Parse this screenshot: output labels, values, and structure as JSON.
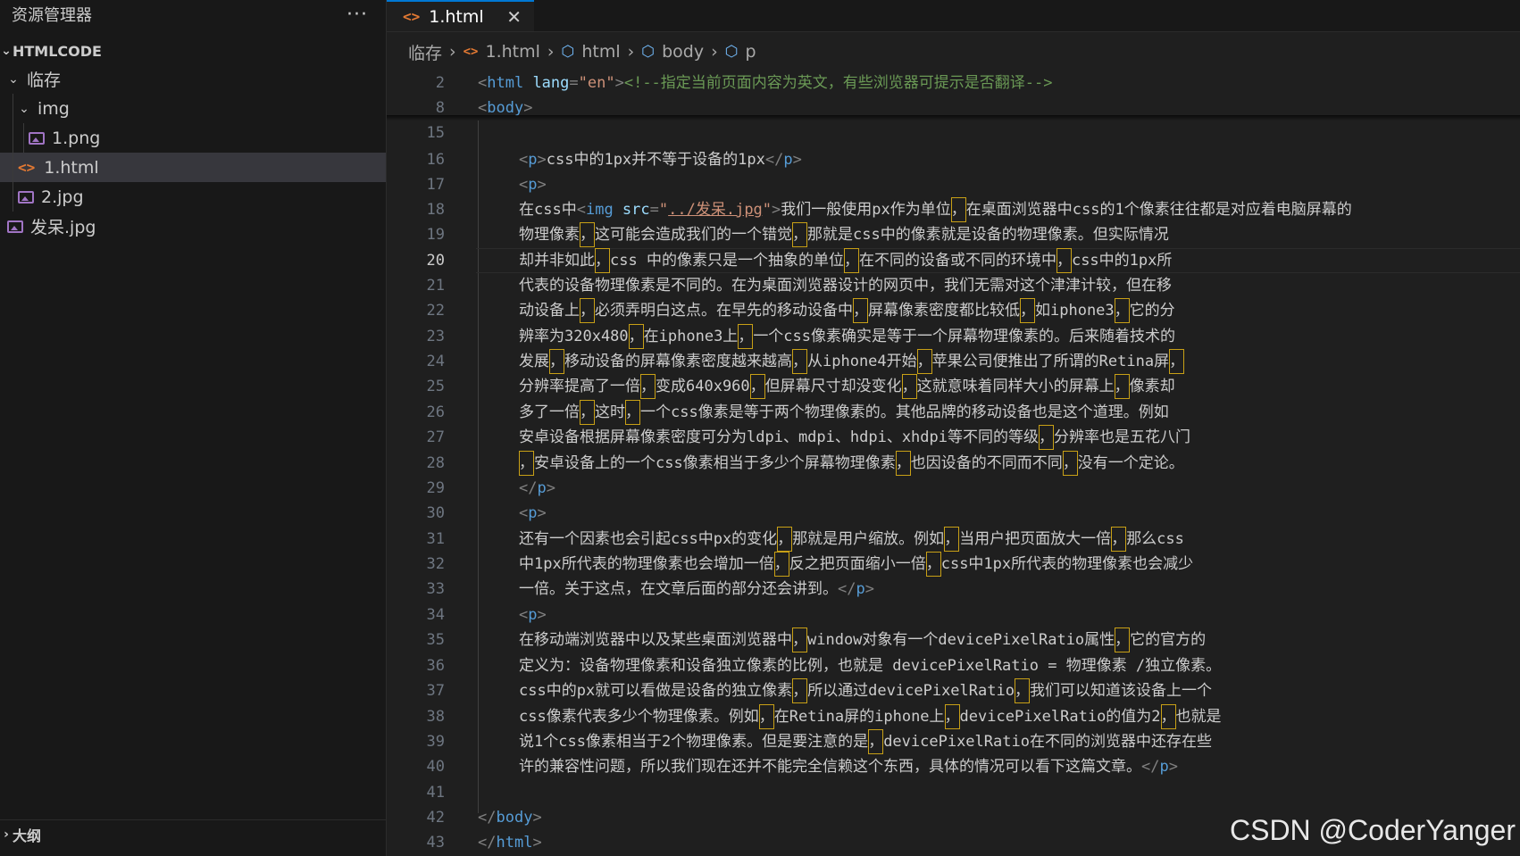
{
  "sidebar": {
    "title": "资源管理器",
    "more": "···",
    "section": "HTMLCODE",
    "items": [
      {
        "label": "临存",
        "kind": "folder"
      },
      {
        "label": "img",
        "kind": "folder"
      },
      {
        "label": "1.png",
        "kind": "image"
      },
      {
        "label": "1.html",
        "kind": "html"
      },
      {
        "label": "2.jpg",
        "kind": "image"
      },
      {
        "label": "发呆.jpg",
        "kind": "image"
      }
    ],
    "outline": "大纲"
  },
  "tab": {
    "label": "1.html",
    "close": "✕"
  },
  "breadcrumb": [
    "临存",
    "1.html",
    "html",
    "body",
    "p"
  ],
  "code": {
    "active_line": "20",
    "lines": [
      {
        "n": "2"
      },
      {
        "n": "8"
      },
      {
        "n": "15"
      },
      {
        "n": "16"
      },
      {
        "n": "17"
      },
      {
        "n": "18"
      },
      {
        "n": "19"
      },
      {
        "n": "20"
      },
      {
        "n": "21"
      },
      {
        "n": "22"
      },
      {
        "n": "23"
      },
      {
        "n": "24"
      },
      {
        "n": "25"
      },
      {
        "n": "26"
      },
      {
        "n": "27"
      },
      {
        "n": "28"
      },
      {
        "n": "29"
      },
      {
        "n": "30"
      },
      {
        "n": "31"
      },
      {
        "n": "32"
      },
      {
        "n": "33"
      },
      {
        "n": "34"
      },
      {
        "n": "35"
      },
      {
        "n": "36"
      },
      {
        "n": "37"
      },
      {
        "n": "38"
      },
      {
        "n": "39"
      },
      {
        "n": "40"
      },
      {
        "n": "41"
      },
      {
        "n": "42"
      },
      {
        "n": "43"
      }
    ],
    "l2": {
      "lt": "<",
      "tag": "html",
      "attr": " lang",
      "eq": "=",
      "val": "\"en\"",
      "gt": ">",
      "comment": "<!--指定当前页面内容为英文，有些浏览器可提示是否翻译-->"
    },
    "l8": {
      "lt": "<",
      "tag": "body",
      "gt": ">"
    },
    "l16": {
      "open": "<",
      "tag": "p",
      "gt": ">",
      "text": "css中的1px并不等于设备的1px",
      "close": "</",
      "ctag": "p",
      "cgt": ">"
    },
    "l17": {
      "lt": "<",
      "tag": "p",
      "gt": ">"
    },
    "l18": {
      "a": "在css中",
      "lt": "<",
      "tag": "img",
      "attr": " src",
      "eq": "=",
      "q1": "\"",
      "val": "../发呆.jpg",
      "q2": "\"",
      "gt": ">",
      "b": "我们一般使用px作为单位",
      "c": "在桌面浏览器中css的1个像素往往都是对应着电脑屏幕的"
    },
    "l19": {
      "a": "物理像素",
      "b": "这可能会造成我们的一个错觉",
      "c": "那就是css中的像素就是设备的物理像素。但实际情况"
    },
    "l20": {
      "a": "却并非如此",
      "b": "css 中的像素只是一个抽象的单位",
      "c": "在不同的设备或不同的环境中",
      "d": "css中的1px所"
    },
    "l21": {
      "a": "代表的设备物理像素是不同的。在为桌面浏览器设计的网页中，我们无需对这个津津计较，但在移"
    },
    "l22": {
      "a": "动设备上",
      "b": "必须弄明白这点。在早先的移动设备中",
      "c": "屏幕像素密度都比较低",
      "d": "如iphone3",
      "e": "它的分"
    },
    "l23": {
      "a": "辨率为320x480",
      "b": "在iphone3上",
      "c": "一个css像素确实是等于一个屏幕物理像素的。后来随着技术的"
    },
    "l24": {
      "a": "发展",
      "b": "移动设备的屏幕像素密度越来越高",
      "c": "从iphone4开始",
      "d": "苹果公司便推出了所谓的Retina屏"
    },
    "l25": {
      "a": "分辨率提高了一倍",
      "b": "变成640x960",
      "c": "但屏幕尺寸却没变化",
      "d": "这就意味着同样大小的屏幕上",
      "e": "像素却"
    },
    "l26": {
      "a": "多了一倍",
      "b": "这时",
      "c": "一个css像素是等于两个物理像素的。其他品牌的移动设备也是这个道理。例如"
    },
    "l27": {
      "a": "安卓设备根据屏幕像素密度可分为ldpi、mdpi、hdpi、xhdpi等不同的等级",
      "b": "分辨率也是五花八门"
    },
    "l28": {
      "a": "安卓设备上的一个css像素相当于多少个屏幕物理像素",
      "b": "也因设备的不同而不同",
      "c": "没有一个定论。"
    },
    "l29": {
      "lt": "</",
      "tag": "p",
      "gt": ">"
    },
    "l30": {
      "lt": "<",
      "tag": "p",
      "gt": ">"
    },
    "l31": {
      "a": "还有一个因素也会引起css中px的变化",
      "b": "那就是用户缩放。例如",
      "c": "当用户把页面放大一倍",
      "d": "那么css"
    },
    "l32": {
      "a": "中1px所代表的物理像素也会增加一倍",
      "b": "反之把页面缩小一倍",
      "c": "css中1px所代表的物理像素也会减少"
    },
    "l33": {
      "a": "一倍。关于这点，在文章后面的部分还会讲到。",
      "lt": "</",
      "tag": "p",
      "gt": ">"
    },
    "l34": {
      "lt": "<",
      "tag": "p",
      "gt": ">"
    },
    "l35": {
      "a": "在移动端浏览器中以及某些桌面浏览器中",
      "b": "window对象有一个devicePixelRatio属性",
      "c": "它的官方的"
    },
    "l36": {
      "a": "定义为：设备物理像素和设备独立像素的比例，也就是 devicePixelRatio = 物理像素 /独立像素。"
    },
    "l37": {
      "a": "css中的px就可以看做是设备的独立像素",
      "b": "所以通过devicePixelRatio",
      "c": "我们可以知道该设备上一个"
    },
    "l38": {
      "a": "css像素代表多少个物理像素。例如",
      "b": "在Retina屏的iphone上",
      "c": "devicePixelRatio的值为2",
      "d": "也就是"
    },
    "l39": {
      "a": "说1个css像素相当于2个物理像素。但是要注意的是",
      "b": "devicePixelRatio在不同的浏览器中还存在些"
    },
    "l40": {
      "a": "许的兼容性问题，所以我们现在还并不能完全信赖这个东西，具体的情况可以看下这篇文章。",
      "lt": "</",
      "tag": "p",
      "gt": ">"
    },
    "l42": {
      "lt": "</",
      "tag": "body",
      "gt": ">"
    },
    "l43": {
      "lt": "</",
      "tag": "html",
      "gt": ">"
    },
    "comma": "，"
  },
  "watermark": "CSDN @CoderYanger",
  "colors": {
    "tag": "#569cd6",
    "attribute": "#9cdcfe",
    "string": "#ce9178",
    "comment": "#6a9955",
    "accent": "#0078d4",
    "html_icon": "#e37933",
    "image_icon": "#a074c4"
  }
}
